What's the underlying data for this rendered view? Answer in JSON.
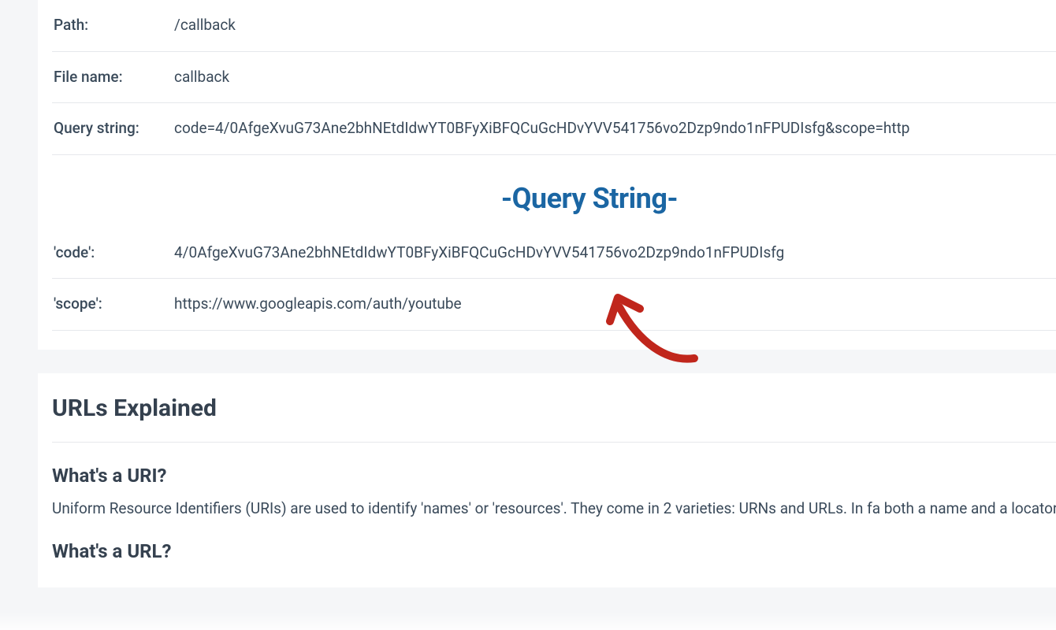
{
  "table1": {
    "rows": [
      {
        "label": "Path:",
        "value": "/callback"
      },
      {
        "label": "File name:",
        "value": "callback"
      },
      {
        "label": "Query string:",
        "value": "code=4/0AfgeXvuG73Ane2bhNEtdIdwYT0BFyXiBFQCuGcHDvYVV541756vo2Dzp9ndo1nFPUDIsfg&scope=http"
      }
    ]
  },
  "querySectionTitle": "-Query String-",
  "table2": {
    "rows": [
      {
        "label": "'code':",
        "value": "4/0AfgeXvuG73Ane2bhNEtdIdwYT0BFyXiBFQCuGcHDvYVV541756vo2Dzp9ndo1nFPUDIsfg"
      },
      {
        "label": "'scope':",
        "value": "https://www.googleapis.com/auth/youtube"
      }
    ]
  },
  "explained": {
    "heading": "URLs Explained",
    "sub1": "What's a URI?",
    "para1": "Uniform Resource Identifiers (URIs) are used to identify 'names' or 'resources'. They come in 2 varieties: URNs and URLs. In fa both a name and a locator!",
    "sub2": "What's a URL?"
  }
}
